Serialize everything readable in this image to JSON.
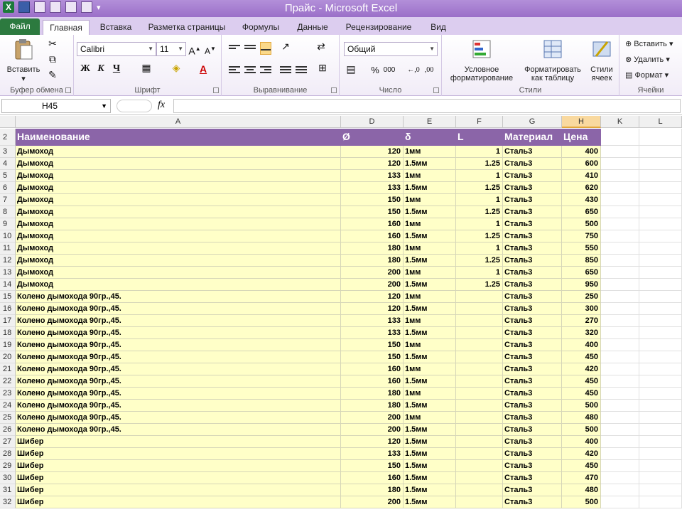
{
  "window": {
    "title": "Прайс - Microsoft Excel"
  },
  "tabs": [
    {
      "label": "Файл"
    },
    {
      "label": "Главная"
    },
    {
      "label": "Вставка"
    },
    {
      "label": "Разметка страницы"
    },
    {
      "label": "Формулы"
    },
    {
      "label": "Данные"
    },
    {
      "label": "Рецензирование"
    },
    {
      "label": "Вид"
    }
  ],
  "ribbon": {
    "clipboard": {
      "label": "Буфер обмена",
      "paste": "Вставить"
    },
    "font": {
      "label": "Шрифт",
      "name": "Calibri",
      "size": "11",
      "bold": "Ж",
      "italic": "К",
      "underline": "Ч"
    },
    "align": {
      "label": "Выравнивание"
    },
    "number": {
      "label": "Число",
      "format": "Общий",
      "percent": "%",
      "thousands": "000"
    },
    "styles": {
      "label": "Стили",
      "cond": "Условное форматирование",
      "table": "Форматировать как таблицу",
      "cell": "Стили ячеек"
    },
    "cells": {
      "label": "Ячейки",
      "insert": "Вставить",
      "delete": "Удалить",
      "format": "Формат"
    }
  },
  "formula_bar": {
    "name_box": "H45",
    "fx": "fx",
    "value": ""
  },
  "columns": [
    "A",
    "D",
    "E",
    "F",
    "G",
    "H",
    "K",
    "L"
  ],
  "header_row": {
    "row": "2",
    "name": "Наименование",
    "d": "Ø",
    "e": "δ",
    "f": "L",
    "g": "Материал",
    "h": "Цена"
  },
  "rows": [
    {
      "n": "3",
      "name": "Дымоход",
      "d": "120",
      "e": "1мм",
      "f": "1",
      "g": "Сталь3",
      "h": "400"
    },
    {
      "n": "4",
      "name": "Дымоход",
      "d": "120",
      "e": "1.5мм",
      "f": "1.25",
      "g": "Сталь3",
      "h": "600"
    },
    {
      "n": "5",
      "name": "Дымоход",
      "d": "133",
      "e": "1мм",
      "f": "1",
      "g": "Сталь3",
      "h": "410"
    },
    {
      "n": "6",
      "name": "Дымоход",
      "d": "133",
      "e": "1.5мм",
      "f": "1.25",
      "g": "Сталь3",
      "h": "620"
    },
    {
      "n": "7",
      "name": "Дымоход",
      "d": "150",
      "e": "1мм",
      "f": "1",
      "g": "Сталь3",
      "h": "430"
    },
    {
      "n": "8",
      "name": "Дымоход",
      "d": "150",
      "e": "1.5мм",
      "f": "1.25",
      "g": "Сталь3",
      "h": "650"
    },
    {
      "n": "9",
      "name": "Дымоход",
      "d": "160",
      "e": "1мм",
      "f": "1",
      "g": "Сталь3",
      "h": "500"
    },
    {
      "n": "10",
      "name": "Дымоход",
      "d": "160",
      "e": "1.5мм",
      "f": "1.25",
      "g": "Сталь3",
      "h": "750"
    },
    {
      "n": "11",
      "name": "Дымоход",
      "d": "180",
      "e": "1мм",
      "f": "1",
      "g": "Сталь3",
      "h": "550"
    },
    {
      "n": "12",
      "name": "Дымоход",
      "d": "180",
      "e": "1.5мм",
      "f": "1.25",
      "g": "Сталь3",
      "h": "850"
    },
    {
      "n": "13",
      "name": "Дымоход",
      "d": "200",
      "e": "1мм",
      "f": "1",
      "g": "Сталь3",
      "h": "650"
    },
    {
      "n": "14",
      "name": "Дымоход",
      "d": "200",
      "e": "1.5мм",
      "f": "1.25",
      "g": "Сталь3",
      "h": "950"
    },
    {
      "n": "15",
      "name": "Колено дымохода 90гр.,45.",
      "d": "120",
      "e": "1мм",
      "f": "",
      "g": "Сталь3",
      "h": "250"
    },
    {
      "n": "16",
      "name": "Колено дымохода 90гр.,45.",
      "d": "120",
      "e": "1.5мм",
      "f": "",
      "g": "Сталь3",
      "h": "300"
    },
    {
      "n": "17",
      "name": "Колено дымохода 90гр.,45.",
      "d": "133",
      "e": "1мм",
      "f": "",
      "g": "Сталь3",
      "h": "270"
    },
    {
      "n": "18",
      "name": "Колено дымохода 90гр.,45.",
      "d": "133",
      "e": "1.5мм",
      "f": "",
      "g": "Сталь3",
      "h": "320"
    },
    {
      "n": "19",
      "name": "Колено дымохода 90гр.,45.",
      "d": "150",
      "e": "1мм",
      "f": "",
      "g": "Сталь3",
      "h": "400"
    },
    {
      "n": "20",
      "name": "Колено дымохода 90гр.,45.",
      "d": "150",
      "e": "1.5мм",
      "f": "",
      "g": "Сталь3",
      "h": "450"
    },
    {
      "n": "21",
      "name": "Колено дымохода 90гр.,45.",
      "d": "160",
      "e": "1мм",
      "f": "",
      "g": "Сталь3",
      "h": "420"
    },
    {
      "n": "22",
      "name": "Колено дымохода 90гр.,45.",
      "d": "160",
      "e": "1.5мм",
      "f": "",
      "g": "Сталь3",
      "h": "450"
    },
    {
      "n": "23",
      "name": "Колено дымохода 90гр.,45.",
      "d": "180",
      "e": "1мм",
      "f": "",
      "g": "Сталь3",
      "h": "450"
    },
    {
      "n": "24",
      "name": "Колено дымохода 90гр.,45.",
      "d": "180",
      "e": "1.5мм",
      "f": "",
      "g": "Сталь3",
      "h": "500"
    },
    {
      "n": "25",
      "name": "Колено дымохода 90гр.,45.",
      "d": "200",
      "e": "1мм",
      "f": "",
      "g": "Сталь3",
      "h": "480"
    },
    {
      "n": "26",
      "name": "Колено дымохода 90гр.,45.",
      "d": "200",
      "e": "1.5мм",
      "f": "",
      "g": "Сталь3",
      "h": "500"
    },
    {
      "n": "27",
      "name": "Шибер",
      "d": "120",
      "e": "1.5мм",
      "f": "",
      "g": "Сталь3",
      "h": "400"
    },
    {
      "n": "28",
      "name": "Шибер",
      "d": "133",
      "e": "1.5мм",
      "f": "",
      "g": "Сталь3",
      "h": "420"
    },
    {
      "n": "29",
      "name": "Шибер",
      "d": "150",
      "e": "1.5мм",
      "f": "",
      "g": "Сталь3",
      "h": "450"
    },
    {
      "n": "30",
      "name": "Шибер",
      "d": "160",
      "e": "1.5мм",
      "f": "",
      "g": "Сталь3",
      "h": "470"
    },
    {
      "n": "31",
      "name": "Шибер",
      "d": "180",
      "e": "1.5мм",
      "f": "",
      "g": "Сталь3",
      "h": "480"
    },
    {
      "n": "32",
      "name": "Шибер",
      "d": "200",
      "e": "1.5мм",
      "f": "",
      "g": "Сталь3",
      "h": "500"
    }
  ]
}
